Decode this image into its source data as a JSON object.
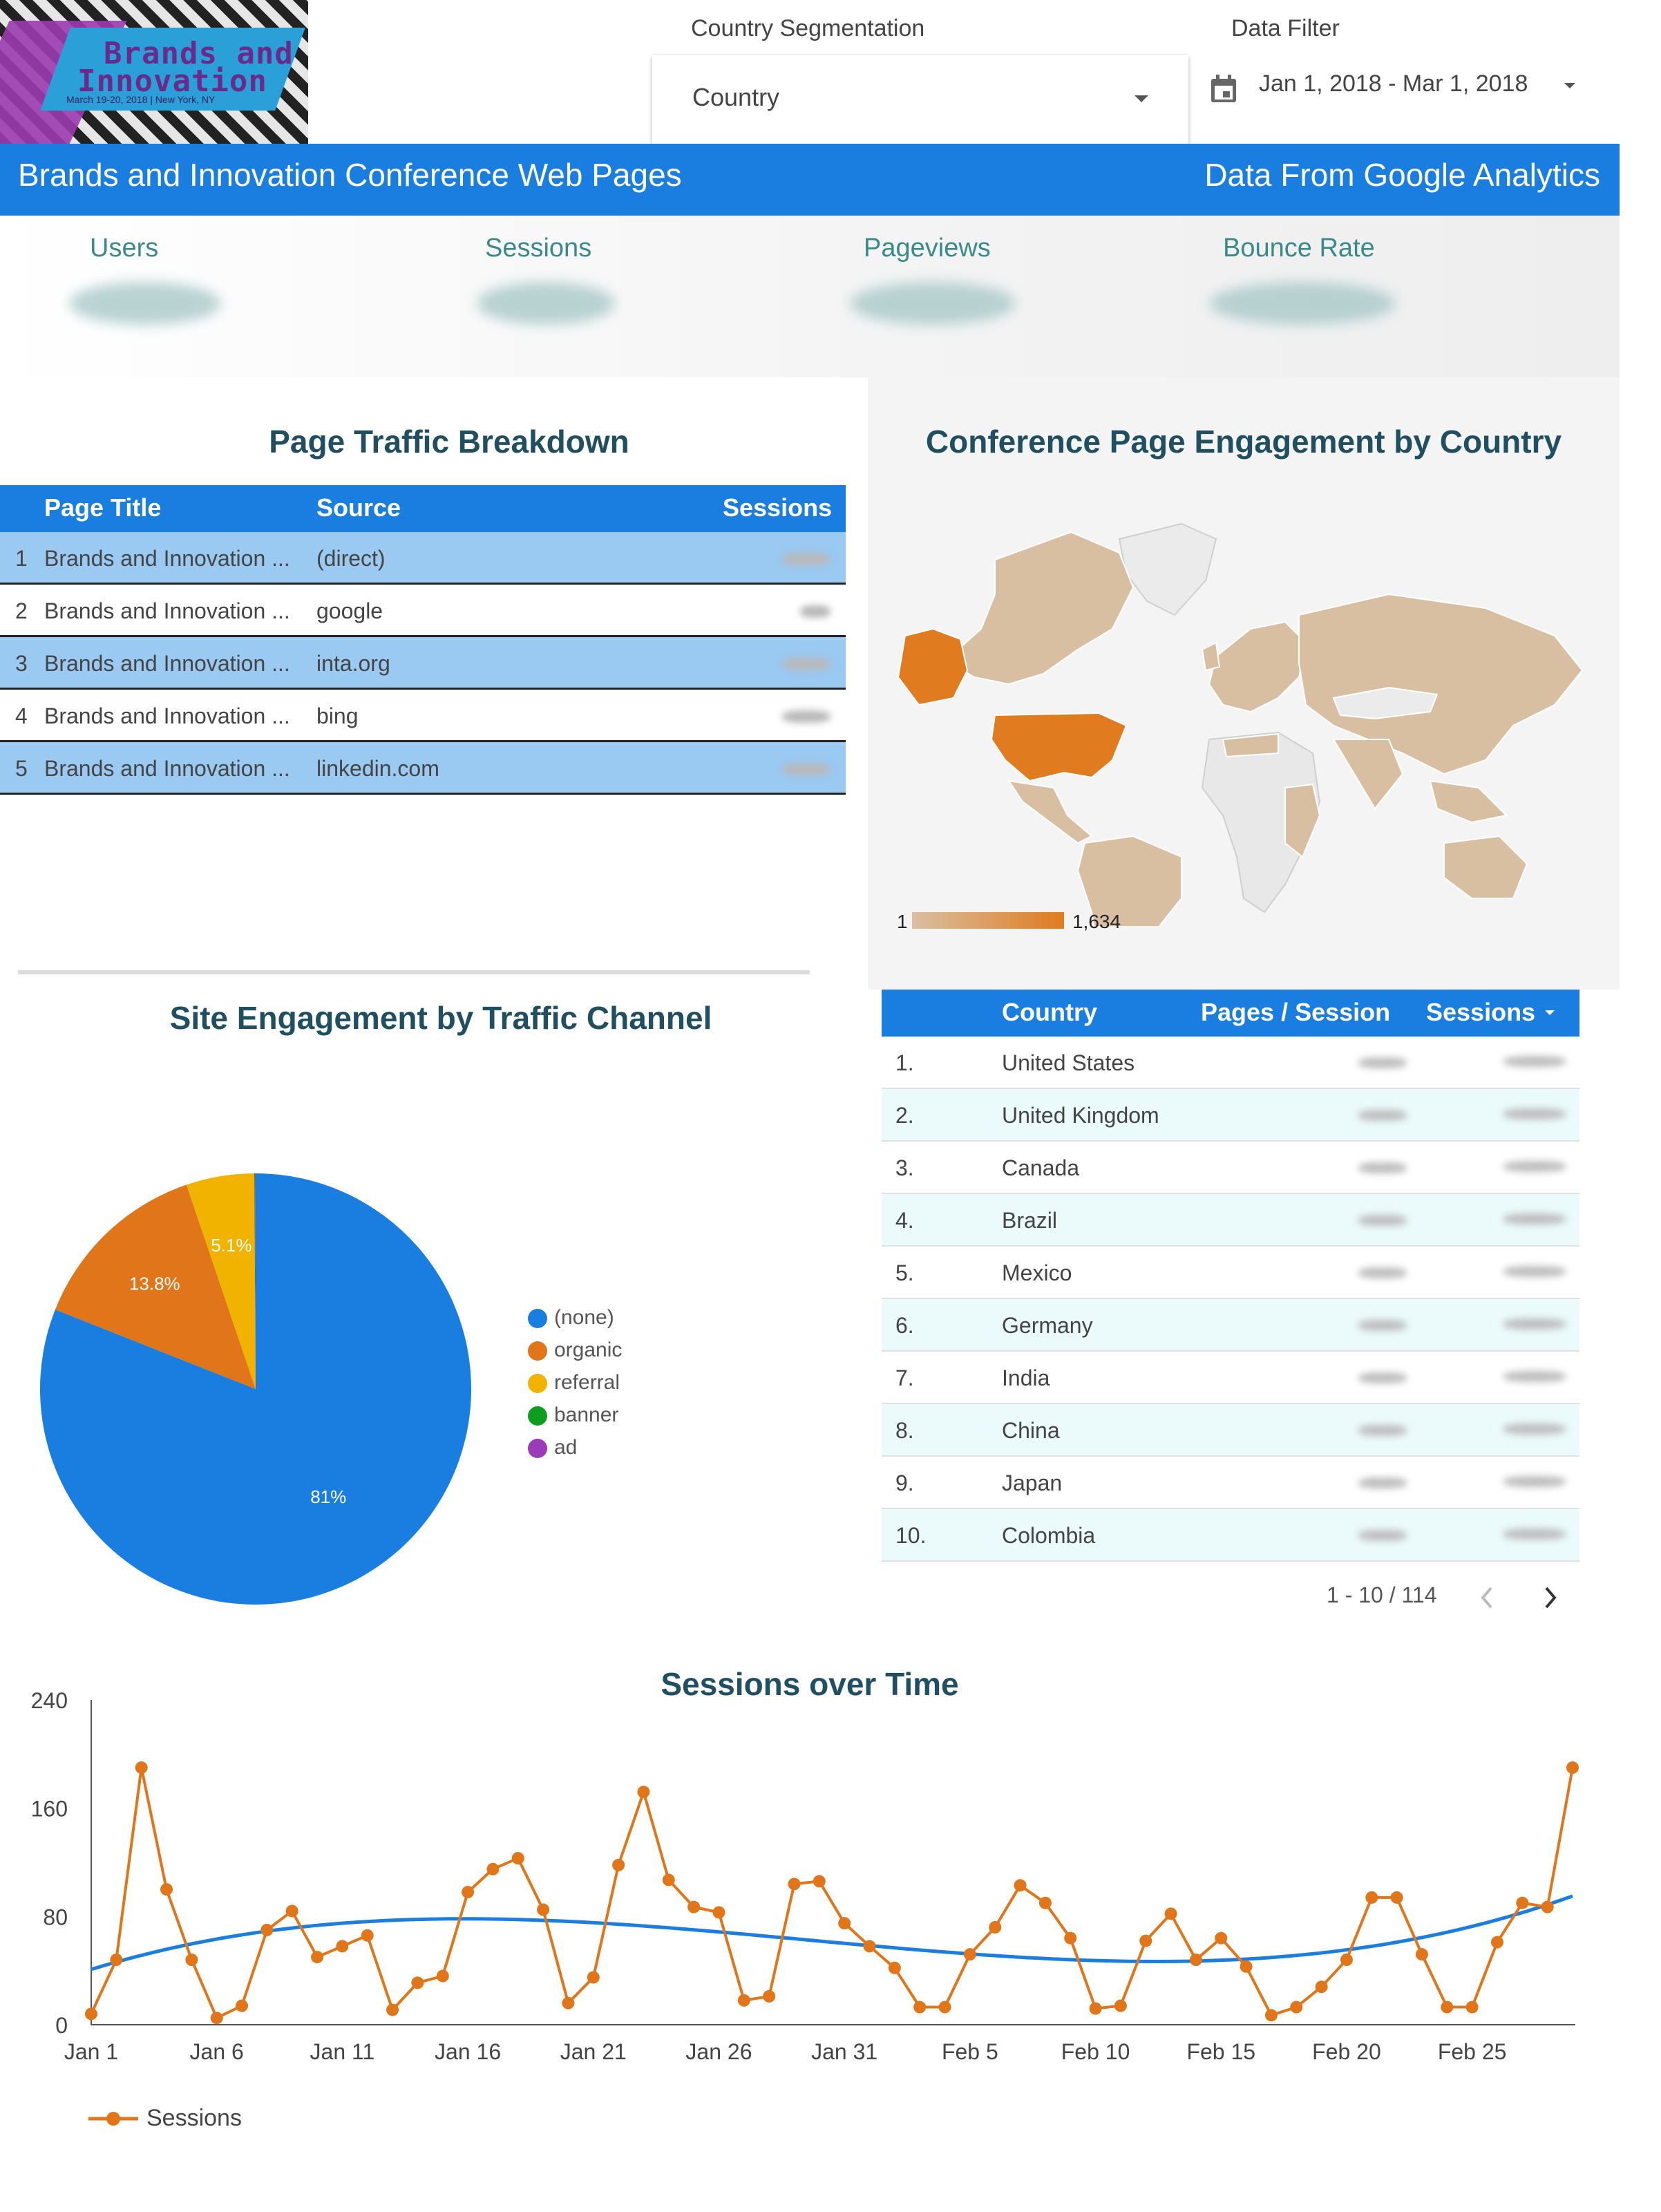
{
  "logo": {
    "line1": "Brands and",
    "line2": "Innovation",
    "line3": "March 19-20, 2018 | New York, NY"
  },
  "controls": {
    "segmentation_label": "Country Segmentation",
    "segmentation_value": "Country",
    "filter_label": "Data Filter",
    "date_range": "Jan 1, 2018 - Mar 1, 2018"
  },
  "header": {
    "title": "Brands and Innovation Conference Web Pages",
    "source": "Data From Google Analytics"
  },
  "kpis": [
    "Users",
    "Sessions",
    "Pageviews",
    "Bounce Rate"
  ],
  "traffic_table": {
    "title": "Page Traffic Breakdown",
    "columns": [
      "Page Title",
      "Source",
      "Sessions"
    ],
    "rows": [
      {
        "n": "1",
        "page": "Brands and Innovation ...",
        "source": "(direct)"
      },
      {
        "n": "2",
        "page": "Brands and Innovation ...",
        "source": "google"
      },
      {
        "n": "3",
        "page": "Brands and Innovation ...",
        "source": "inta.org"
      },
      {
        "n": "4",
        "page": "Brands and Innovation ...",
        "source": "bing"
      },
      {
        "n": "5",
        "page": "Brands and Innovation ...",
        "source": "linkedin.com"
      }
    ]
  },
  "map": {
    "title": "Conference Page Engagement by Country",
    "scale_min": "1",
    "scale_max": "1,634",
    "colors": {
      "low": "#d9bfa2",
      "high": "#e07b1f",
      "none": "#e8e8e8"
    }
  },
  "country_table": {
    "columns": [
      "Country",
      "Pages / Session",
      "Sessions"
    ],
    "rows": [
      {
        "n": "1.",
        "country": "United States"
      },
      {
        "n": "2.",
        "country": "United Kingdom"
      },
      {
        "n": "3.",
        "country": "Canada"
      },
      {
        "n": "4.",
        "country": "Brazil"
      },
      {
        "n": "5.",
        "country": "Mexico"
      },
      {
        "n": "6.",
        "country": "Germany"
      },
      {
        "n": "7.",
        "country": "India"
      },
      {
        "n": "8.",
        "country": "China"
      },
      {
        "n": "9.",
        "country": "Japan"
      },
      {
        "n": "10.",
        "country": "Colombia"
      }
    ],
    "pager": "1 - 10 / 114"
  },
  "chart_data": [
    {
      "type": "pie",
      "title": "Site Engagement by Traffic Channel",
      "slices": [
        {
          "label": "(none)",
          "value": 81,
          "display": "81%",
          "color": "#1a7ee0"
        },
        {
          "label": "organic",
          "value": 13.8,
          "display": "13.8%",
          "color": "#e07519"
        },
        {
          "label": "referral",
          "value": 5.1,
          "display": "5.1%",
          "color": "#f2b200"
        },
        {
          "label": "banner",
          "value": 0.05,
          "display": "",
          "color": "#0f9d1f"
        },
        {
          "label": "ad",
          "value": 0.05,
          "display": "",
          "color": "#9c3bb8"
        }
      ]
    },
    {
      "type": "line",
      "title": "Sessions over Time",
      "ylim": [
        0,
        240
      ],
      "yticks": [
        0,
        80,
        160,
        240
      ],
      "xtick_labels": [
        "Jan 1",
        "Jan 6",
        "Jan 11",
        "Jan 16",
        "Jan 21",
        "Jan 26",
        "Jan 31",
        "Feb 5",
        "Feb 10",
        "Feb 15",
        "Feb 20",
        "Feb 25"
      ],
      "series": [
        {
          "name": "Sessions",
          "color": "#e07519",
          "values": [
            8,
            48,
            190,
            100,
            48,
            5,
            14,
            70,
            84,
            50,
            58,
            66,
            11,
            31,
            36,
            98,
            115,
            123,
            85,
            16,
            35,
            118,
            172,
            107,
            87,
            83,
            18,
            21,
            104,
            106,
            75,
            58,
            42,
            13,
            13,
            52,
            72,
            103,
            90,
            64,
            12,
            14,
            62,
            82,
            48,
            64,
            43,
            7,
            13,
            28,
            48,
            94,
            94,
            52,
            13,
            13,
            61,
            90,
            87,
            190
          ]
        }
      ],
      "trendline_color": "#1a7ee0"
    }
  ]
}
